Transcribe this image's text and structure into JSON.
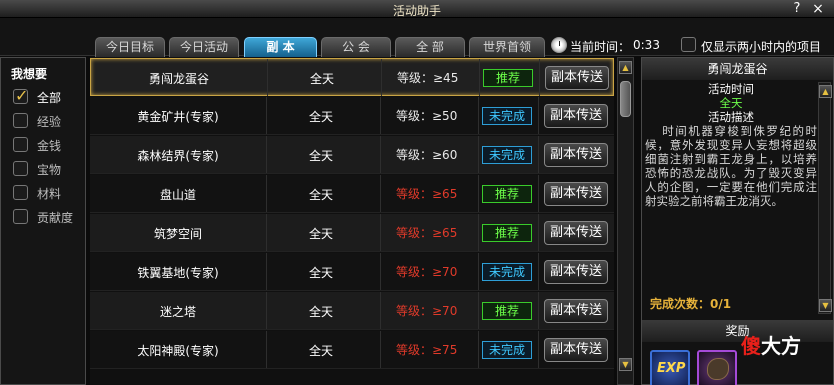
{
  "window": {
    "title": "活动助手",
    "help": "?",
    "close": "×"
  },
  "tabs": [
    {
      "label": "今日目标"
    },
    {
      "label": "今日活动"
    },
    {
      "label": "副 本",
      "active": true
    },
    {
      "label": "公 会"
    },
    {
      "label": "全 部"
    },
    {
      "label": "世界首领"
    }
  ],
  "header": {
    "time_label": "当前时间：",
    "time_value": "0:33",
    "two_hour_label": "仅显示两小时内的项目",
    "two_hour_checked": false
  },
  "filters": {
    "title": "我想要",
    "items": [
      {
        "label": "全部",
        "checked": true
      },
      {
        "label": "经验",
        "checked": false
      },
      {
        "label": "金钱",
        "checked": false
      },
      {
        "label": "宝物",
        "checked": false
      },
      {
        "label": "材料",
        "checked": false
      },
      {
        "label": "贡献度",
        "checked": false
      }
    ]
  },
  "activities": [
    {
      "name": "勇闯龙蛋谷",
      "time": "全天",
      "level": "等级：≥45",
      "level_ok": true,
      "status": "推荐",
      "status_type": "green",
      "button": "副本传送",
      "selected": true
    },
    {
      "name": "黄金矿井(专家)",
      "time": "全天",
      "level": "等级：≥50",
      "level_ok": true,
      "status": "未完成",
      "status_type": "blue",
      "button": "副本传送"
    },
    {
      "name": "森林结界(专家)",
      "time": "全天",
      "level": "等级：≥60",
      "level_ok": true,
      "status": "未完成",
      "status_type": "blue",
      "button": "副本传送"
    },
    {
      "name": "盘山道",
      "time": "全天",
      "level": "等级：≥65",
      "level_ok": false,
      "status": "推荐",
      "status_type": "green",
      "button": "副本传送"
    },
    {
      "name": "筑梦空间",
      "time": "全天",
      "level": "等级：≥65",
      "level_ok": false,
      "status": "推荐",
      "status_type": "green",
      "button": "副本传送"
    },
    {
      "name": "铁翼基地(专家)",
      "time": "全天",
      "level": "等级：≥70",
      "level_ok": false,
      "status": "未完成",
      "status_type": "blue",
      "button": "副本传送"
    },
    {
      "name": "迷之塔",
      "time": "全天",
      "level": "等级：≥70",
      "level_ok": false,
      "status": "推荐",
      "status_type": "green",
      "button": "副本传送"
    },
    {
      "name": "太阳神殿(专家)",
      "time": "全天",
      "level": "等级：≥75",
      "level_ok": false,
      "status": "未完成",
      "status_type": "blue",
      "button": "副本传送"
    }
  ],
  "detail": {
    "title": "勇闯龙蛋谷",
    "time_head": "活动时间",
    "time_value": "全天",
    "desc_head": "活动描述",
    "desc": "时间机器穿梭到侏罗纪的时候，意外发现变异人妄想将超级细菌注射到霸王龙身上，以培养恐怖的恐龙战队。为了毁灭变异人的企图，一定要在他们完成注射实验之前将霸王龙消灭。",
    "complete_label": "完成次数：0/1",
    "reward_title": "奖励",
    "reward_exp": "EXP"
  },
  "watermark": {
    "part1": "傻",
    "part2": "大方"
  },
  "colors": {
    "accent_gold": "#c9a444",
    "recommend_green": "#6dff4a",
    "incomplete_blue": "#3fc8ff",
    "level_red": "#e03a2a"
  }
}
